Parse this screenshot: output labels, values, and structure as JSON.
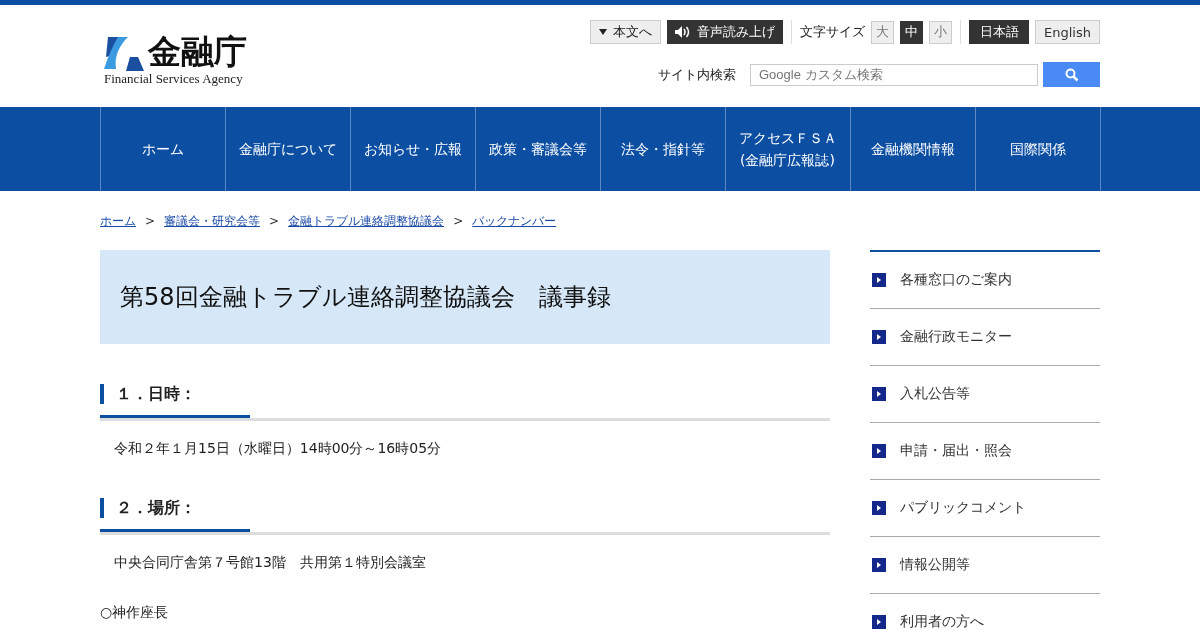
{
  "logo": {
    "title": "金融庁",
    "subtitle": "Financial Services Agency"
  },
  "utility": {
    "skip_link": "本文へ",
    "read_aloud": "音声読み上げ",
    "font_size_label": "文字サイズ",
    "font_sizes": [
      {
        "label": "大",
        "selected": false
      },
      {
        "label": "中",
        "selected": true
      },
      {
        "label": "小",
        "selected": false
      }
    ],
    "languages": [
      {
        "label": "日本語",
        "selected": true
      },
      {
        "label": "English",
        "selected": false
      }
    ]
  },
  "search": {
    "label": "サイト内検索",
    "placeholder": "Google カスタム検索"
  },
  "nav": [
    {
      "label": "ホーム"
    },
    {
      "label": "金融庁について"
    },
    {
      "label": "お知らせ・広報"
    },
    {
      "label": "政策・審議会等"
    },
    {
      "label": "法令・指針等"
    },
    {
      "label": "アクセスＦＳＡ\n(金融庁広報誌)"
    },
    {
      "label": "金融機関情報"
    },
    {
      "label": "国際関係"
    }
  ],
  "breadcrumb": [
    {
      "label": "ホーム"
    },
    {
      "separator": ">",
      "label": "審議会・研究会等"
    },
    {
      "separator": ">",
      "label": "金融トラブル連絡調整協議会"
    },
    {
      "separator": ">",
      "label": "バックナンバー"
    }
  ],
  "page_title": "第58回金融トラブル連絡調整協議会　議事録",
  "sections": [
    {
      "heading": "１．日時：",
      "text": "令和２年１月15日（水曜日）14時00分～16時05分"
    },
    {
      "heading": "２．場所：",
      "text": "中央合同庁舎第７号館13階　共用第１特別会議室"
    }
  ],
  "trailing_text": "○神作座長",
  "sidebar": [
    "各種窓口のご案内",
    "金融行政モニター",
    "入札公告等",
    "申請・届出・照会",
    "パブリックコメント",
    "情報公開等",
    "利用者の方へ"
  ]
}
